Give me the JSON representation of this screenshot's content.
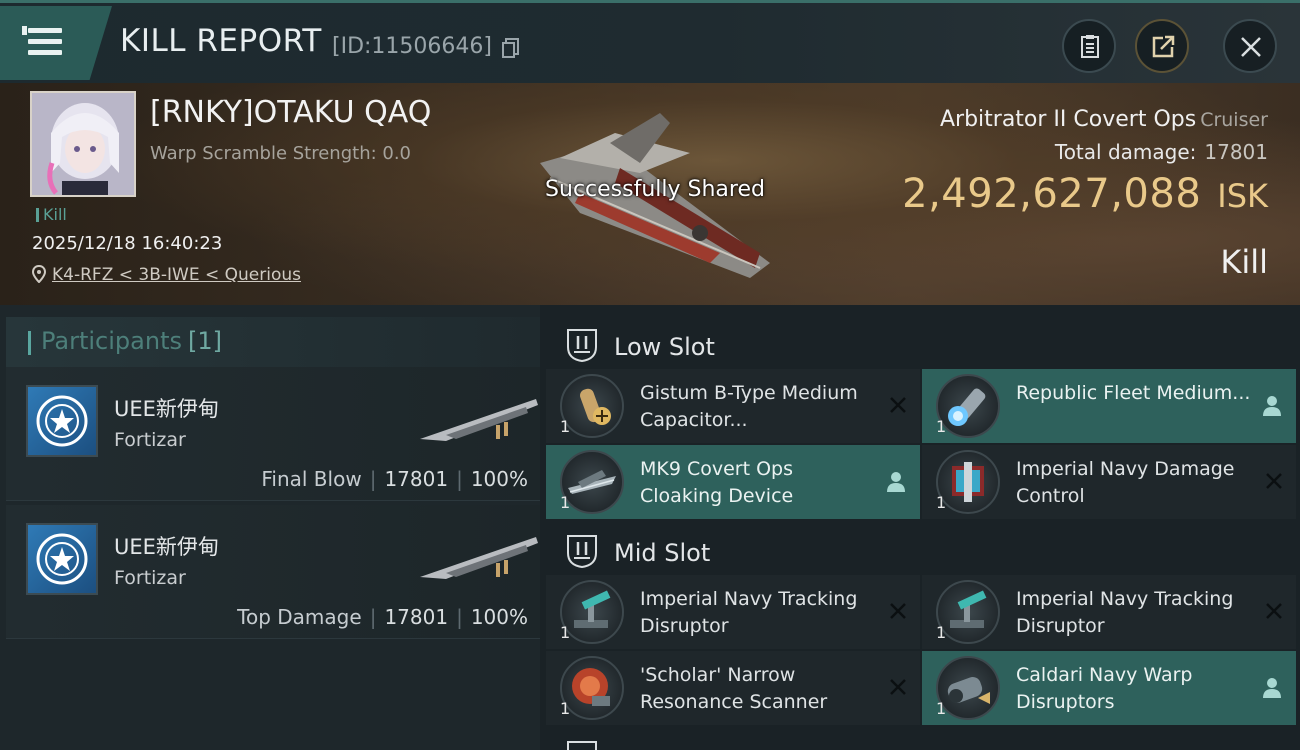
{
  "header": {
    "title": "KILL REPORT",
    "report_id": "[ID:11506646]",
    "icons": [
      "menu-icon",
      "copy-icon",
      "clipboard-icon",
      "share-icon",
      "close-icon"
    ]
  },
  "banner": {
    "pilot_name": "[RNKY]OTAKU QAQ",
    "warp_scramble": "Warp Scramble Strength: 0.0",
    "kill_tag": "Kill",
    "datetime": "2025/12/18 16:40:23",
    "location": "K4-RFZ < 3B-IWE < Querious",
    "shared_message": "Successfully Shared",
    "ship_name": "Arbitrator II Covert Ops",
    "ship_class": "Cruiser",
    "total_damage_label": "Total damage:",
    "total_damage_value": "17801",
    "isk_amount": "2,492,627,088",
    "isk_unit": "ISK",
    "result": "Kill"
  },
  "participants": {
    "title": "Participants",
    "count": "[1]",
    "rows": [
      {
        "name": "UEE新伊甸",
        "ship": "Fortizar",
        "label": "Final Blow",
        "damage": "17801",
        "percent": "100%"
      },
      {
        "name": "UEE新伊甸",
        "ship": "Fortizar",
        "label": "Top Damage",
        "damage": "17801",
        "percent": "100%"
      }
    ]
  },
  "slots": {
    "low": {
      "title": "Low Slot",
      "items": [
        {
          "name": "Gistum B-Type Medium Capacitor...",
          "qty": "1",
          "status": "destroyed"
        },
        {
          "name": "Republic Fleet Medium...",
          "qty": "1",
          "status": "dropped"
        },
        {
          "name": "MK9 Covert Ops Cloaking Device",
          "qty": "1",
          "status": "dropped"
        },
        {
          "name": "Imperial Navy Damage Control",
          "qty": "1",
          "status": "destroyed"
        }
      ]
    },
    "mid": {
      "title": "Mid Slot",
      "items": [
        {
          "name": "Imperial Navy Tracking Disruptor",
          "qty": "1",
          "status": "destroyed"
        },
        {
          "name": "Imperial Navy Tracking Disruptor",
          "qty": "1",
          "status": "destroyed"
        },
        {
          "name": "'Scholar' Narrow Resonance Scanner",
          "qty": "1",
          "status": "destroyed"
        },
        {
          "name": "Caldari Navy Warp Disruptors",
          "qty": "1",
          "status": "dropped"
        }
      ]
    }
  },
  "colors": {
    "accent_teal": "#2e615c",
    "isk_gold": "#e9c98a",
    "background": "#1b2226"
  }
}
